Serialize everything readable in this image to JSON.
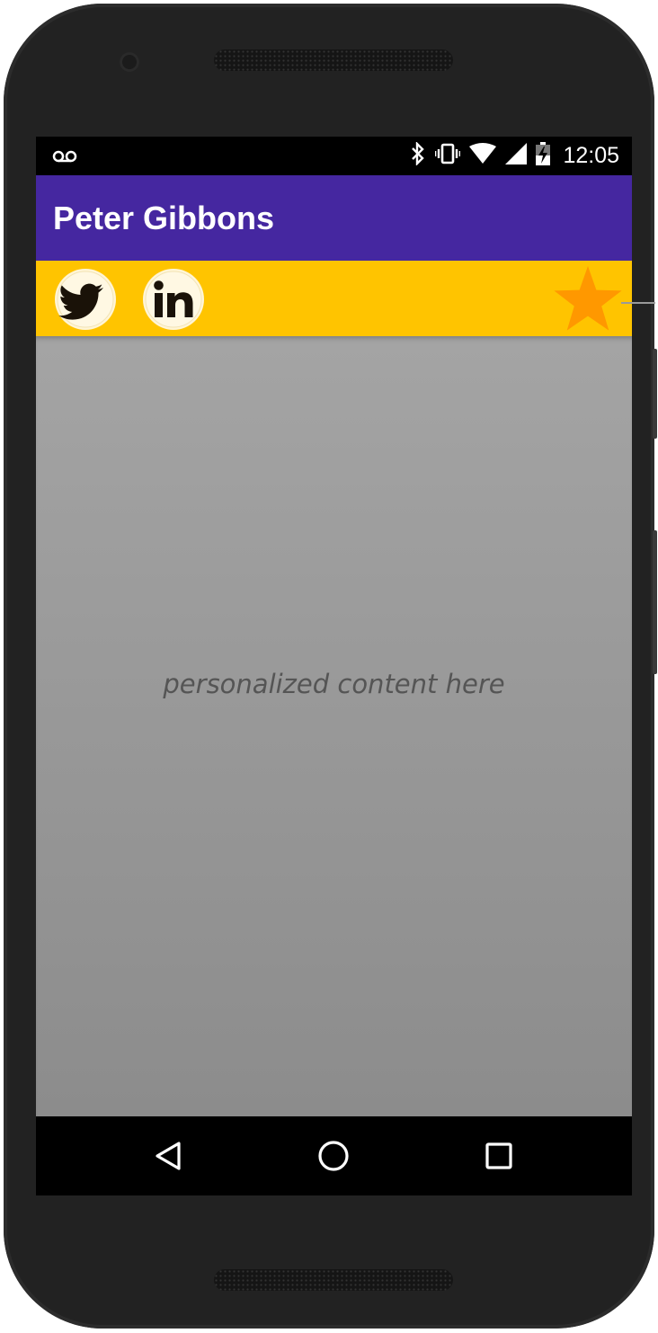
{
  "status_bar": {
    "time": "12:05",
    "icons": [
      "voicemail-icon",
      "bluetooth-icon",
      "vibrate-icon",
      "wifi-icon",
      "cell-signal-icon",
      "battery-charging-icon"
    ]
  },
  "app_bar": {
    "title": "Peter Gibbons",
    "background_color": "#4527a0"
  },
  "social_bar": {
    "background_color": "#ffc400",
    "icons": [
      "twitter-icon",
      "linkedin-icon"
    ],
    "star_color": "#ff9800"
  },
  "content": {
    "placeholder_text": "personalized content here"
  },
  "nav_bar": {
    "buttons": [
      "back-icon",
      "home-icon",
      "recents-icon"
    ]
  }
}
